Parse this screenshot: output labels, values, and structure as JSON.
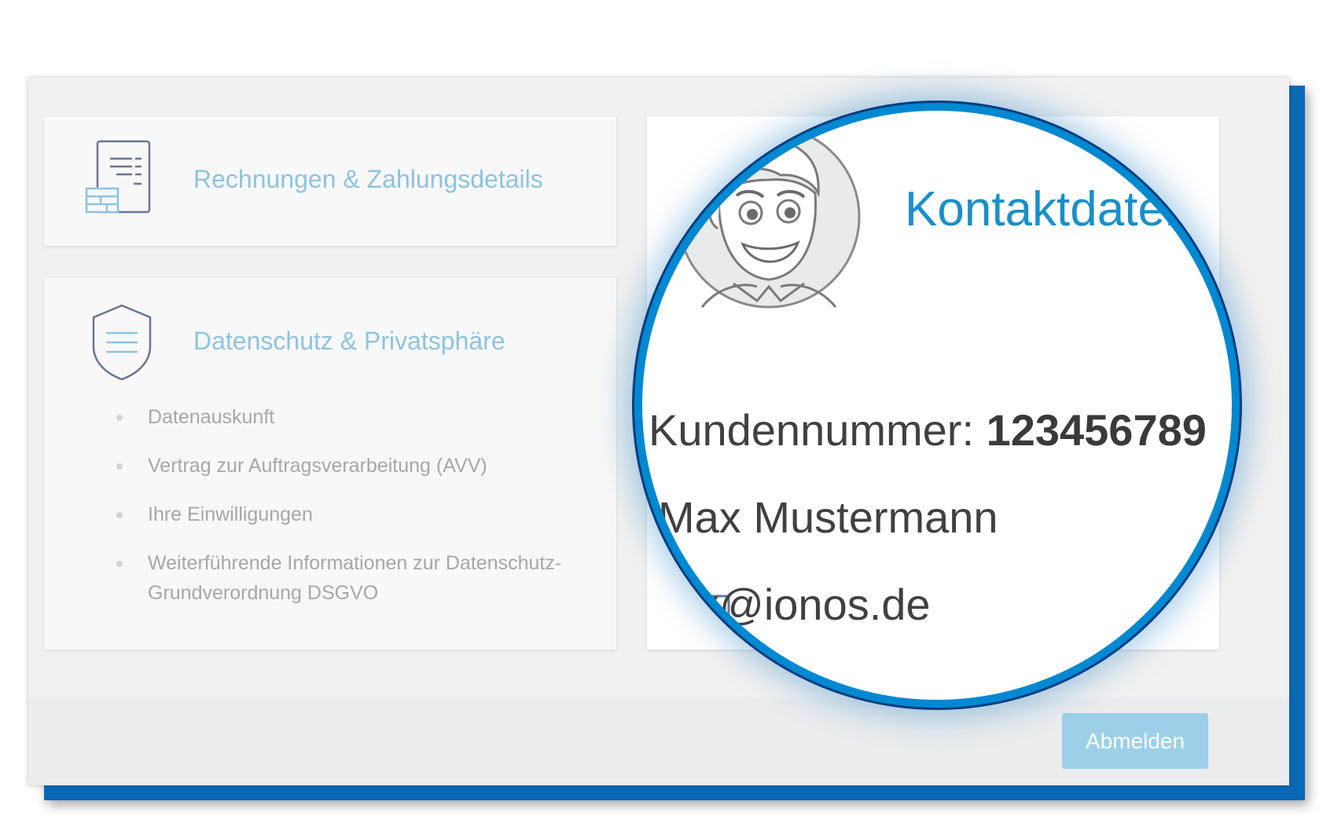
{
  "cards": {
    "invoices": {
      "title": "Rechnungen & Zahlungsdetails",
      "icon": "invoice-icon"
    },
    "privacy": {
      "title": "Datenschutz & Privatsphäre",
      "icon": "shield-icon",
      "items": [
        {
          "label": "Datenauskunft"
        },
        {
          "label": "Vertrag zur Auftragsverarbeitung (AVV)"
        },
        {
          "label": "Ihre Einwilligungen"
        },
        {
          "label": "Weiterführende Informationen zur Datenschutz-Grundverordnung DSGVO"
        }
      ]
    },
    "contact": {
      "title": "Kontaktdaten",
      "customer_label": "Kundennummer:",
      "customer_number": "123456789",
      "name": "Max Mustermann",
      "email": "x@ionos.de",
      "avatar_icon": "avatar-illustration",
      "email_icon": "mail-icon"
    }
  },
  "footer": {
    "logout_label": "Abmelden"
  },
  "colors": {
    "accent": "#0088d1",
    "title_light": "#8ec3e0",
    "button": "#9dd0e8",
    "shadow_blue": "#0a69b7"
  }
}
